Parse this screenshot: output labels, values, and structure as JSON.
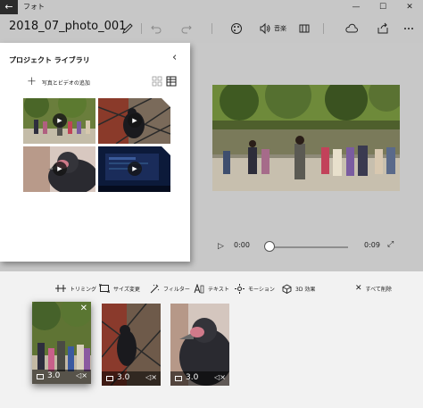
{
  "window": {
    "title": "フォト",
    "back_glyph": "←",
    "minimize_glyph": "—",
    "maximize_glyph": "☐",
    "close_glyph": "✕"
  },
  "toolbar": {
    "file_title": "2018_07_photo_001",
    "audio_label": "音楽"
  },
  "library": {
    "title": "プロジェクト ライブラリ",
    "collapse_glyph": "‹",
    "add_label": "写真とビデオの追加",
    "add_glyph": "+",
    "thumbnails": [
      {
        "name": "zoo-crowd-video",
        "type": "video"
      },
      {
        "name": "crow-on-fence-video",
        "type": "video"
      },
      {
        "name": "crow-closeup-photo",
        "type": "photo"
      },
      {
        "name": "screen-recording-video",
        "type": "video"
      }
    ],
    "play_glyph": "▶"
  },
  "player": {
    "play_glyph": "▷",
    "current_time": "0:00",
    "end_time": "0:09",
    "progress": 0.0,
    "fullscreen_glyph": "⤢"
  },
  "edit_tools": {
    "trim": "トリミング",
    "resize": "サイズ変更",
    "filters": "フィルター",
    "text": "テキスト",
    "motion": "モーション",
    "effects_3d": "3D 効果",
    "remove_all": "すべて削除",
    "remove_glyph": "✕"
  },
  "storyboard": {
    "cards": [
      {
        "name": "zoo-crowd-card",
        "duration": "3.0",
        "selected": true
      },
      {
        "name": "crow-fence-card",
        "duration": "3.0",
        "selected": false
      },
      {
        "name": "crow-closeup-card",
        "duration": "3.0",
        "selected": false
      }
    ],
    "close_glyph": "✕",
    "mute_glyph": "🔇"
  },
  "colors": {
    "chrome": "#c7c7c7",
    "preview_bg": "#c8c8c8",
    "panel_bg": "#ffffff",
    "strip_bg": "#f2f2f2"
  }
}
